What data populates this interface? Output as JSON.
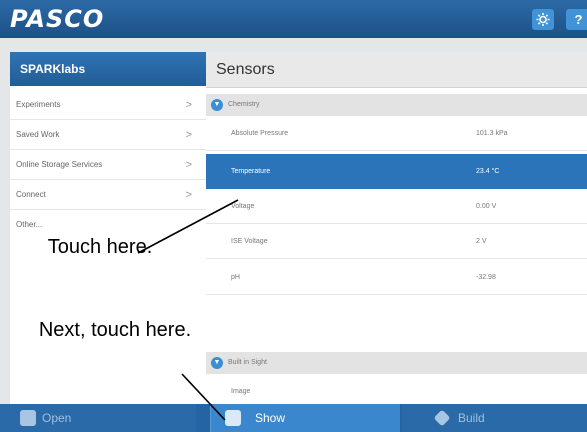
{
  "app": {
    "logo_text": "PASCO"
  },
  "topbar": {
    "gear_icon": "settings-icon",
    "help_label": "?"
  },
  "sidebar": {
    "title": "SPARKlabs",
    "items": [
      {
        "label": "Experiments",
        "chevron": ">"
      },
      {
        "label": "Saved Work",
        "chevron": ">"
      },
      {
        "label": "Online Storage Services",
        "chevron": ">"
      },
      {
        "label": "Connect",
        "chevron": ">"
      },
      {
        "label": "Other...",
        "chevron": ""
      }
    ]
  },
  "main": {
    "title": "Sensors",
    "groups": [
      {
        "label": "Chemistry",
        "rows": [
          {
            "name": "Absolute Pressure",
            "value": "101.3 kPa",
            "selected": false
          },
          {
            "name": "Temperature",
            "value": "23.4 °C",
            "selected": true
          },
          {
            "name": "Voltage",
            "value": "0.00 V",
            "selected": false
          },
          {
            "name": "ISE Voltage",
            "value": "2 V",
            "selected": false
          },
          {
            "name": "pH",
            "value": "-32.98",
            "selected": false
          }
        ]
      },
      {
        "label": "Built in Sight",
        "rows": [
          {
            "name": "Image",
            "value": "",
            "selected": false
          }
        ]
      }
    ]
  },
  "bottombar": {
    "open_label": "Open",
    "show_label": "Show",
    "build_label": "Build"
  },
  "annotations": {
    "first": "Touch here.",
    "second": "Next, touch here."
  },
  "colors": {
    "topbar": "#1e5088",
    "selected_row": "#2c74b9",
    "bottombar": "#2564a4"
  }
}
